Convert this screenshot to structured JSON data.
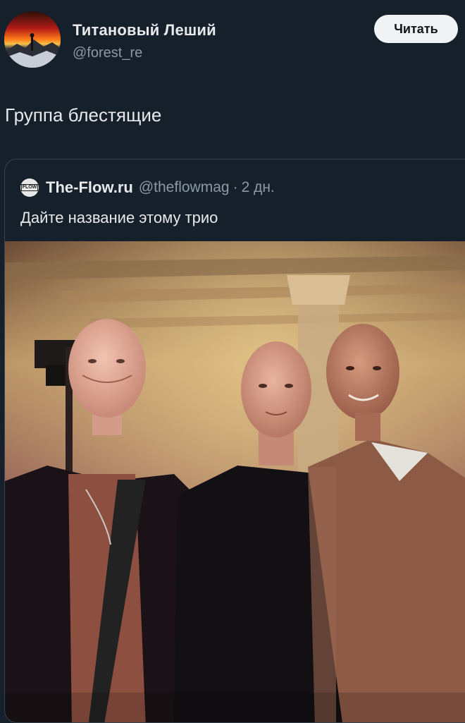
{
  "author": {
    "display_name": "Титановый Леший",
    "handle": "@forest_re",
    "avatar_icon": "sunset-mountain-avatar-icon"
  },
  "follow_button": {
    "label": "Читать"
  },
  "post": {
    "text": "Группа блестящие"
  },
  "quoted_post": {
    "avatar_label": "FLOW",
    "display_name": "The-Flow.ru",
    "handle": "@theflowmag",
    "separator": "·",
    "time": "2 дн.",
    "text": "Дайте название этому трио",
    "photo_icon": "three-bald-men-photo"
  },
  "colors": {
    "background": "#15202b",
    "text_primary": "#e7e9ea",
    "text_secondary": "#8b98a5",
    "button_bg": "#eff3f4",
    "border": "#38444d"
  }
}
